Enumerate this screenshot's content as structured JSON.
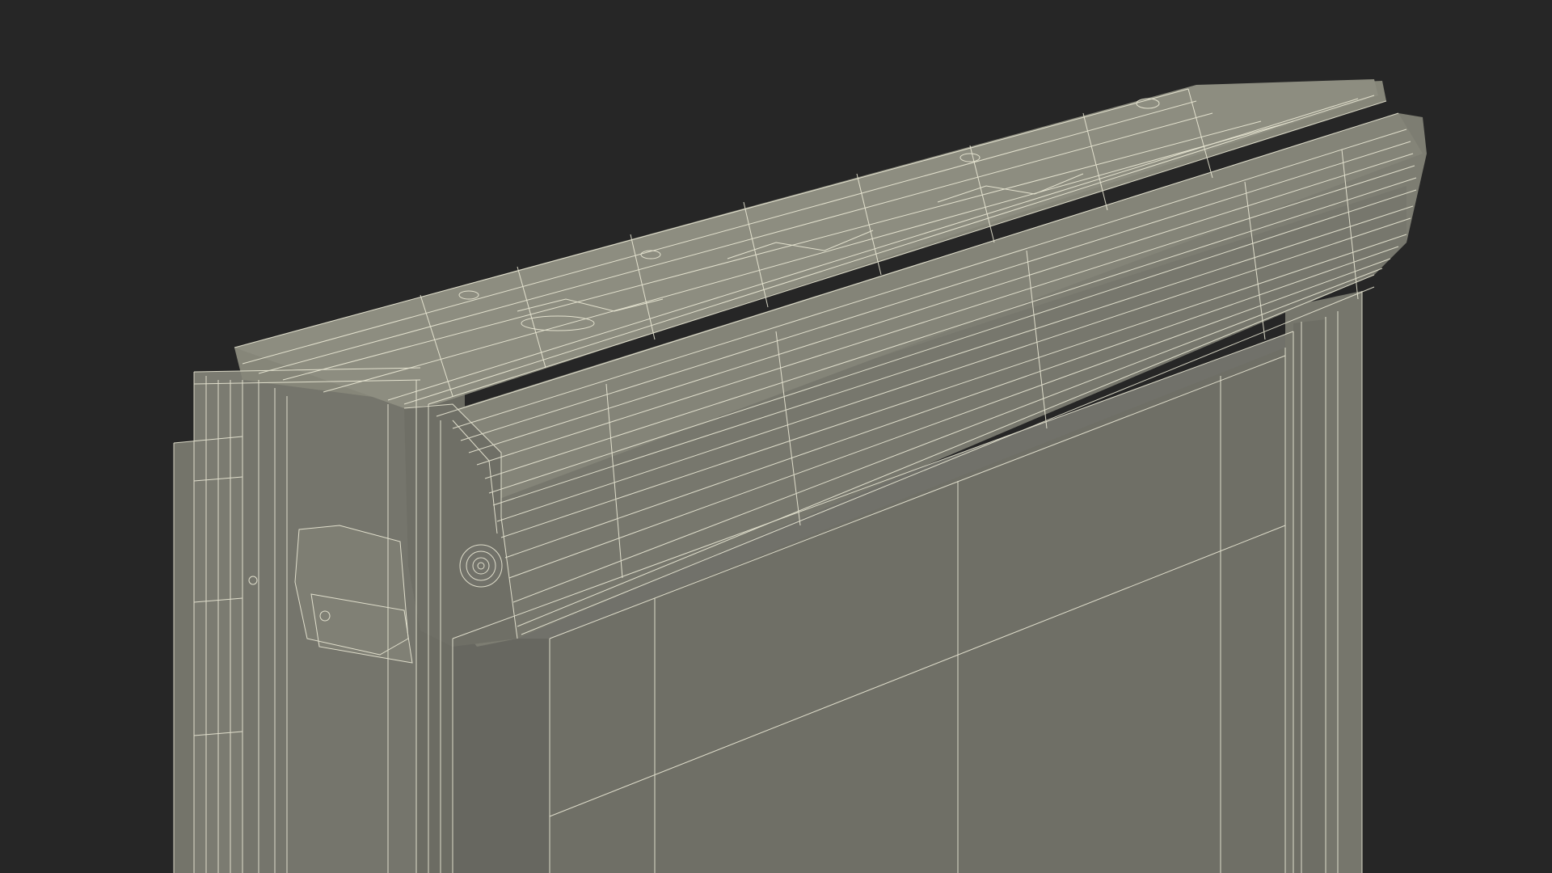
{
  "scene": {
    "subject": "roller-shutter-box-wireframe",
    "colors": {
      "background": "#262626",
      "shell_light": "#8a8a80",
      "shell_mid": "#7a7a70",
      "shell_dark": "#6a6a62",
      "panel": "#727268",
      "panel_shade": "#65655d",
      "wire": "#f2f0dc",
      "wire_dim": "#d8d6c2"
    }
  }
}
